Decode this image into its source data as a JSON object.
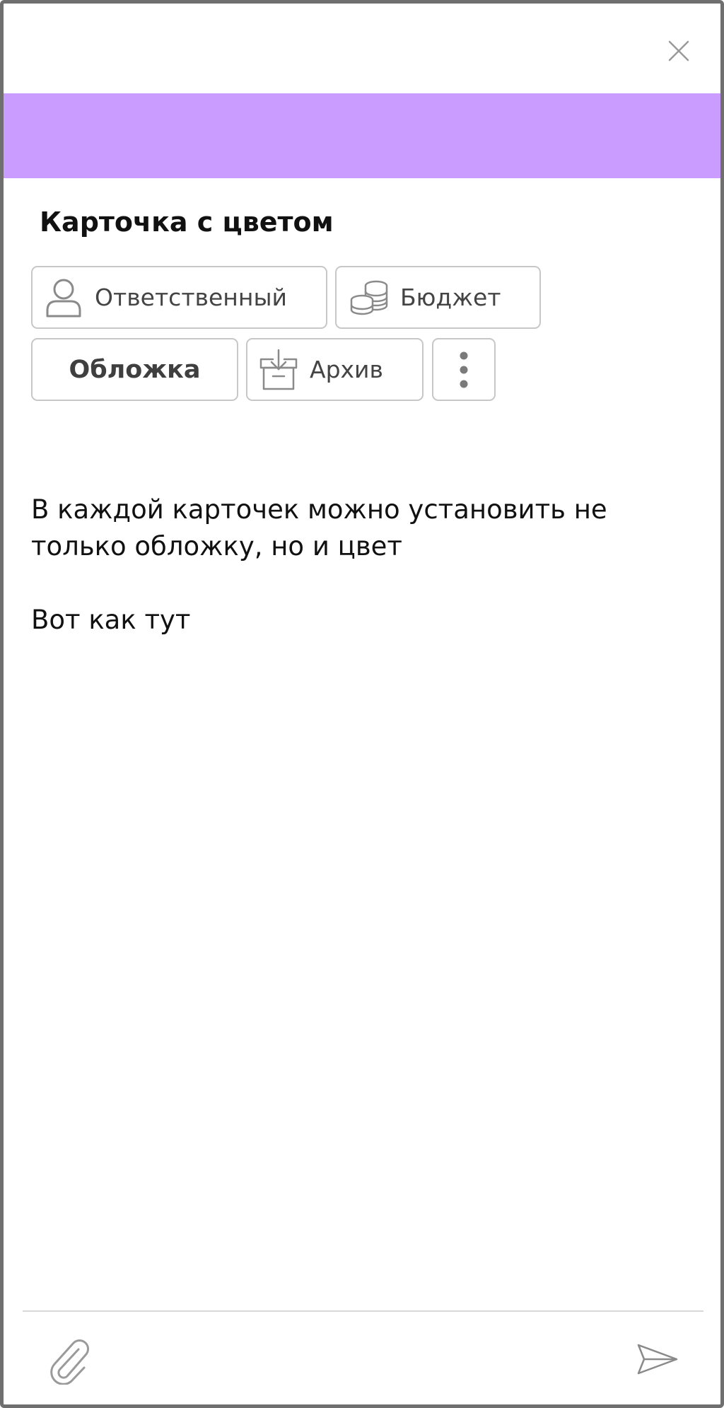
{
  "card": {
    "title": "Карточка с цветом",
    "color": "#cb9cff"
  },
  "actions": {
    "responsible_label": "Ответственный",
    "budget_label": "Бюджет",
    "cover_label": "Обложка",
    "archive_label": "Архив"
  },
  "description": {
    "line1": "В каждой карточек можно установить не только обложку, но и цвет",
    "line2": "Вот как тут"
  },
  "icons": {
    "close": "close-icon",
    "responsible": "user-icon",
    "budget": "coins-icon",
    "archive": "archive-icon",
    "more": "more-vertical-icon",
    "attach": "paperclip-icon",
    "send": "send-icon"
  }
}
